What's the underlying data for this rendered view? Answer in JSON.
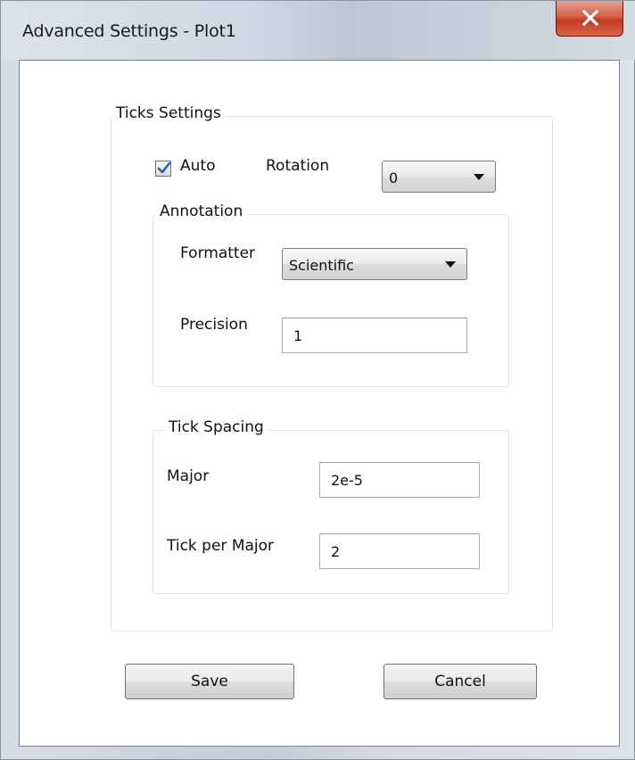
{
  "window": {
    "title": "Advanced Settings - Plot1"
  },
  "ticks_settings": {
    "legend": "Ticks Settings",
    "auto_label": "Auto",
    "auto_checked": true,
    "rotation_label": "Rotation",
    "rotation_value": "0"
  },
  "annotation": {
    "legend": "Annotation",
    "formatter_label": "Formatter",
    "formatter_value": "Scientific",
    "precision_label": "Precision",
    "precision_value": "1"
  },
  "tick_spacing": {
    "legend": "Tick Spacing",
    "major_label": "Major",
    "major_value": "2e-5",
    "tick_per_major_label": "Tick per Major",
    "tick_per_major_value": "2"
  },
  "buttons": {
    "save_label": "Save",
    "cancel_label": "Cancel"
  },
  "icons": {
    "close": "close-icon",
    "check": "checkmark-icon",
    "dropdown": "chevron-down-icon"
  },
  "colors": {
    "close_button": "#c4391f",
    "checkmark": "#1f5fbf"
  }
}
